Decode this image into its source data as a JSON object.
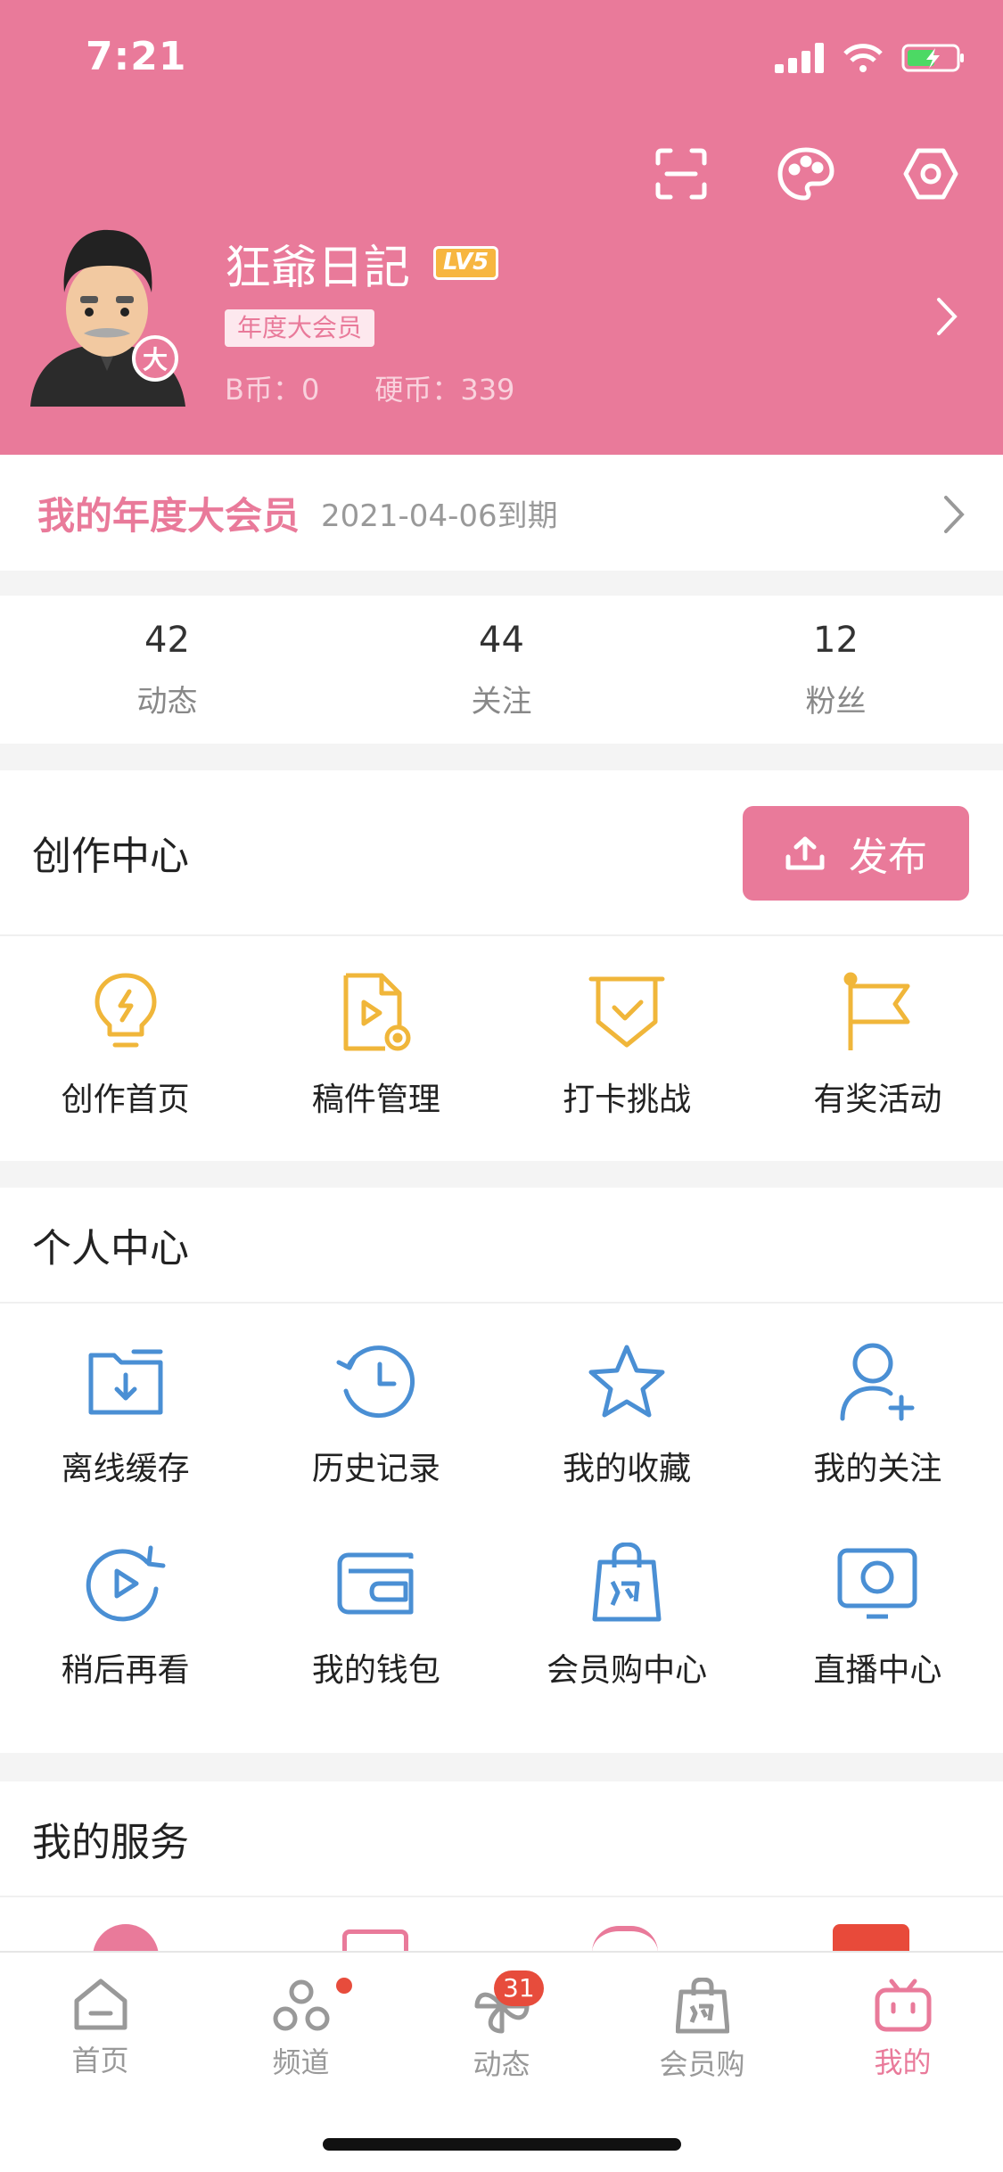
{
  "status": {
    "time": "7:21"
  },
  "profile": {
    "name": "狂爺日記",
    "level": "LV5",
    "avatar_badge": "大",
    "vip_tag": "年度大会员",
    "bcoin": "B币：0",
    "coins": "硬币：339"
  },
  "vip": {
    "title": "我的年度大会员",
    "expire": "2021-04-06到期"
  },
  "stats": [
    {
      "value": "42",
      "label": "动态"
    },
    {
      "value": "44",
      "label": "关注"
    },
    {
      "value": "12",
      "label": "粉丝"
    }
  ],
  "creation": {
    "title": "创作中心",
    "publish": "发布",
    "items": [
      {
        "label": "创作首页",
        "icon": "bulb-icon"
      },
      {
        "label": "稿件管理",
        "icon": "file-play-icon"
      },
      {
        "label": "打卡挑战",
        "icon": "check-shield-icon"
      },
      {
        "label": "有奖活动",
        "icon": "flag-icon"
      }
    ]
  },
  "personal": {
    "title": "个人中心",
    "items": [
      {
        "label": "离线缓存",
        "icon": "download-folder-icon"
      },
      {
        "label": "历史记录",
        "icon": "history-icon"
      },
      {
        "label": "我的收藏",
        "icon": "star-icon"
      },
      {
        "label": "我的关注",
        "icon": "add-user-icon"
      },
      {
        "label": "稍后再看",
        "icon": "replay-icon"
      },
      {
        "label": "我的钱包",
        "icon": "wallet-icon"
      },
      {
        "label": "会员购中心",
        "icon": "shopping-bag-icon"
      },
      {
        "label": "直播中心",
        "icon": "live-tv-icon"
      }
    ]
  },
  "services": {
    "title": "我的服务"
  },
  "nav": {
    "items": [
      {
        "label": "首页",
        "icon": "home-icon"
      },
      {
        "label": "频道",
        "icon": "channel-icon"
      },
      {
        "label": "动态",
        "icon": "pinwheel-icon",
        "badge": "31"
      },
      {
        "label": "会员购",
        "icon": "shopping-bag-icon"
      },
      {
        "label": "我的",
        "icon": "tv-icon"
      }
    ]
  },
  "colors": {
    "brand": "#e97a9a",
    "creation_icons": "#f0b63a",
    "personal_icons": "#4a8fd4"
  }
}
